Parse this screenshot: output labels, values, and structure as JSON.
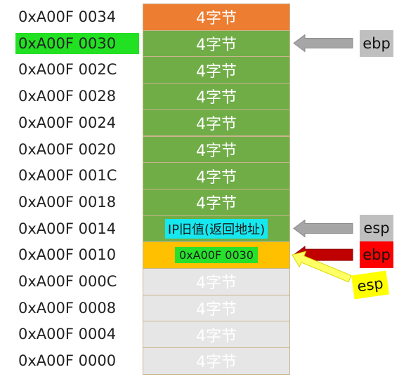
{
  "stack": {
    "rows": [
      {
        "address": "0xA00F 0034",
        "cell": "4字节",
        "fill": "#ed7d31",
        "cell_style": "plain",
        "addr_highlight": false
      },
      {
        "address": "0xA00F 0030",
        "cell": "4字节",
        "fill": "#70ad47",
        "cell_style": "plain",
        "addr_highlight": true
      },
      {
        "address": "0xA00F 002C",
        "cell": "4字节",
        "fill": "#70ad47",
        "cell_style": "plain",
        "addr_highlight": false
      },
      {
        "address": "0xA00F 0028",
        "cell": "4字节",
        "fill": "#70ad47",
        "cell_style": "plain",
        "addr_highlight": false
      },
      {
        "address": "0xA00F 0024",
        "cell": "4字节",
        "fill": "#70ad47",
        "cell_style": "plain",
        "addr_highlight": false
      },
      {
        "address": "0xA00F 0020",
        "cell": "4字节",
        "fill": "#70ad47",
        "cell_style": "plain",
        "addr_highlight": false
      },
      {
        "address": "0xA00F 001C",
        "cell": "4字节",
        "fill": "#70ad47",
        "cell_style": "plain",
        "addr_highlight": false
      },
      {
        "address": "0xA00F 0018",
        "cell": "4字节",
        "fill": "#70ad47",
        "cell_style": "plain",
        "addr_highlight": false
      },
      {
        "address": "0xA00F 0014",
        "cell": "IP旧值(返回地址)",
        "fill": "#70ad47",
        "cell_style": "ip",
        "addr_highlight": false
      },
      {
        "address": "0xA00F 0010",
        "cell": "0xA00F 0030",
        "fill": "#ffc000",
        "cell_style": "val",
        "addr_highlight": false
      },
      {
        "address": "0xA00F 000C",
        "cell": "4字节",
        "fill": "#e7e6e6",
        "cell_style": "plain",
        "addr_highlight": false
      },
      {
        "address": "0xA00F 0008",
        "cell": "4字节",
        "fill": "#e7e6e6",
        "cell_style": "plain",
        "addr_highlight": false
      },
      {
        "address": "0xA00F 0004",
        "cell": "4字节",
        "fill": "#e7e6e6",
        "cell_style": "plain",
        "addr_highlight": false
      },
      {
        "address": "0xA00F 0000",
        "cell": "4字节",
        "fill": "#e7e6e6",
        "cell_style": "plain",
        "addr_highlight": false
      }
    ],
    "address_highlight_color": "#22e022"
  },
  "pointers": [
    {
      "label": "ebp",
      "row": 1,
      "style": "gray",
      "arrow_color": "#a6a6a6",
      "label_bg": "#bfbfbf",
      "label_color": "#111111"
    },
    {
      "label": "esp",
      "row": 8,
      "style": "gray",
      "arrow_color": "#a6a6a6",
      "label_bg": "#bfbfbf",
      "label_color": "#111111"
    },
    {
      "label": "ebp",
      "row": 9,
      "style": "red",
      "arrow_color": "#c00000",
      "label_bg": "#ff0000",
      "label_color": "#111111"
    },
    {
      "label": "esp",
      "row": 9,
      "style": "yellow",
      "arrow_color": "#ffff66",
      "label_bg": "#ffff00",
      "label_color": "#111111"
    }
  ]
}
